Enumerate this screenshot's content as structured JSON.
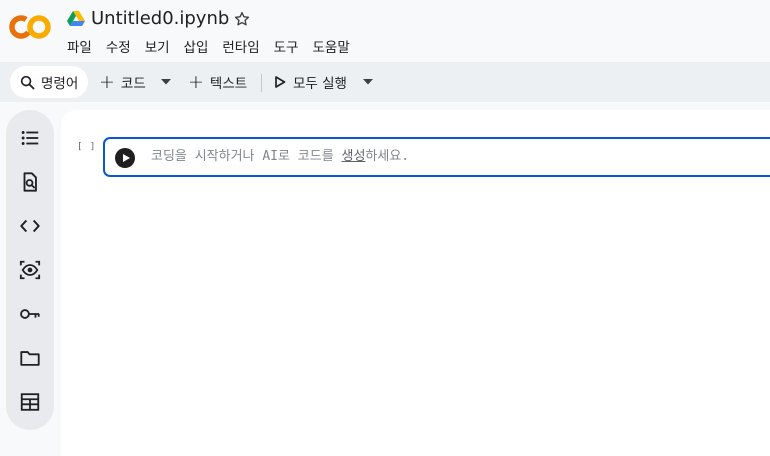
{
  "app": {
    "logo_text": "CO",
    "brand_colors": {
      "logo_orange": "#f9ab00",
      "logo_dark_orange": "#e8710a",
      "focus_blue": "#0b57d0"
    },
    "document_title": "Untitled0.ipynb"
  },
  "menu": {
    "items": [
      {
        "label": "파일"
      },
      {
        "label": "수정"
      },
      {
        "label": "보기"
      },
      {
        "label": "삽입"
      },
      {
        "label": "런타임"
      },
      {
        "label": "도구"
      },
      {
        "label": "도움말"
      }
    ]
  },
  "toolbar": {
    "command_label": "명령어",
    "add_code_label": "코드",
    "add_text_label": "텍스트",
    "run_all_label": "모두 실행"
  },
  "sidebar": {
    "items": [
      {
        "icon": "table-of-contents-icon"
      },
      {
        "icon": "find-replace-icon"
      },
      {
        "icon": "code-snippets-icon"
      },
      {
        "icon": "variables-inspector-icon"
      },
      {
        "icon": "secrets-key-icon"
      },
      {
        "icon": "files-folder-icon"
      },
      {
        "icon": "data-table-icon"
      }
    ]
  },
  "cell": {
    "execution_count": "[ ]",
    "placeholder_prefix": "코딩을 시작하거나 AI로 코드를 ",
    "placeholder_link": "생성",
    "placeholder_suffix": "하세요."
  }
}
